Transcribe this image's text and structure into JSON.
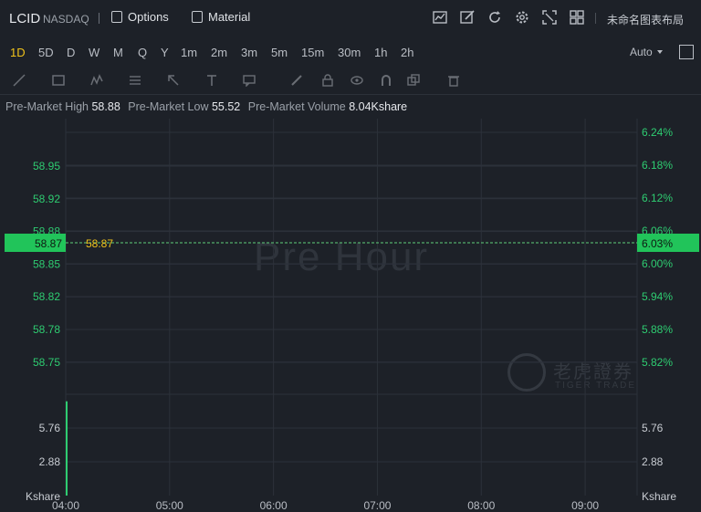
{
  "header": {
    "symbol": "LCID",
    "exchange": "NASDAQ",
    "options_label": "Options",
    "material_label": "Material",
    "layout_name": "未命名图表布局"
  },
  "periods": [
    "1D",
    "5D",
    "D",
    "W",
    "M",
    "Q",
    "Y",
    "1m",
    "2m",
    "3m",
    "5m",
    "15m",
    "30m",
    "1h",
    "2h"
  ],
  "active_period": "1D",
  "scale_mode": "Auto",
  "info": {
    "high_label": "Pre-Market High",
    "high_value": "58.88",
    "low_label": "Pre-Market Low",
    "low_value": "55.52",
    "volume_label": "Pre-Market Volume",
    "volume_value": "8.04Kshare"
  },
  "watermark": "Pre Hour",
  "brand": {
    "cn": "老虎證券",
    "en": "TIGER TRADE"
  },
  "colors": {
    "up": "#2ecc71",
    "price_tag": "#21c45a",
    "current_price_text": "#f0c21a",
    "active": "#f0c21a"
  },
  "chart_data": {
    "type": "line",
    "price_ticks": [
      "58.95",
      "58.92",
      "58.88",
      "58.85",
      "58.82",
      "58.78",
      "58.75"
    ],
    "percent_ticks": [
      "6.24%",
      "6.18%",
      "6.12%",
      "6.06%",
      "6.00%",
      "5.94%",
      "5.88%",
      "5.82%"
    ],
    "current_price": "58.87",
    "current_percent": "6.03%",
    "volume_ticks": [
      "5.76",
      "2.88"
    ],
    "volume_unit": "Kshare",
    "x_ticks": [
      "04:00",
      "05:00",
      "06:00",
      "07:00",
      "08:00",
      "09:00"
    ],
    "volume_bars": [
      {
        "time": "04:00",
        "value": 8.04
      }
    ]
  }
}
